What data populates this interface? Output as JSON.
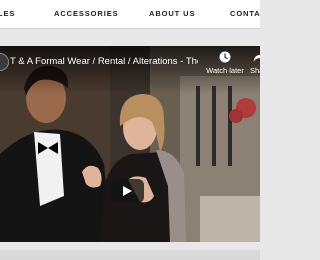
{
  "nav": {
    "items": [
      {
        "label": "LES"
      },
      {
        "label": "ACCESSORIES"
      },
      {
        "label": "ABOUT US"
      },
      {
        "label": "CONTACT"
      }
    ]
  },
  "video": {
    "title": "T & A Formal Wear / Rental / Alterations - The ...",
    "watch_later_label": "Watch later",
    "share_label": "Share"
  },
  "colors": {
    "nav_background": "#ffffff",
    "nav_text": "#222222",
    "page_background": "#e7e7e7",
    "video_overlay_text": "#ffffff",
    "play_button": "#141414"
  },
  "icons": {
    "watch_later": "clock-icon",
    "share": "share-arrow-icon",
    "play": "play-icon"
  }
}
